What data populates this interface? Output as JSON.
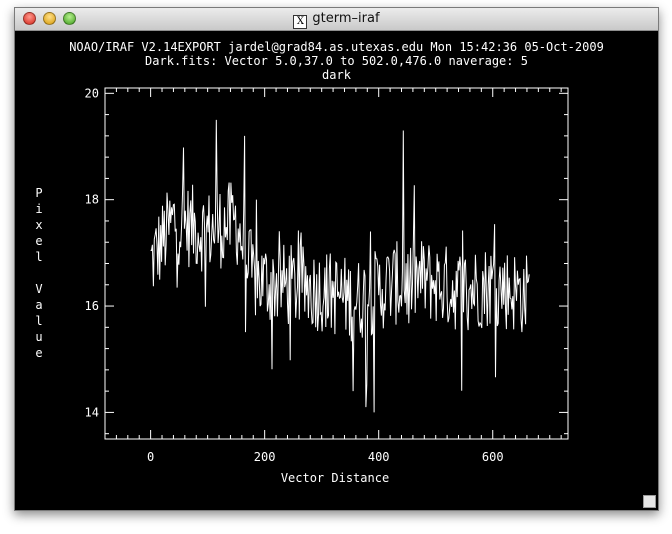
{
  "window": {
    "title": "gterm–iraf",
    "icon": "x11-icon"
  },
  "header": {
    "line1": "NOAO/IRAF V2.14EXPORT jardel@grad84.as.utexas.edu Mon 15:42:36 05-Oct-2009",
    "line2": "Dark.fits: Vector 5.0,37.0 to 502.0,476.0 naverage: 5",
    "line3": "dark"
  },
  "chart_data": {
    "type": "line",
    "title": "dark",
    "xlabel": "Vector Distance",
    "ylabel": "Pixel Value",
    "xlim": [
      -80,
      732
    ],
    "ylim": [
      13.5,
      20.1
    ],
    "xticks": [
      0,
      200,
      400,
      600
    ],
    "yticks": [
      14,
      16,
      18,
      20
    ],
    "x_start": 0,
    "x_end": 665,
    "series": [
      {
        "color": "#ffffff",
        "trend_x": [
          0,
          40,
          100,
          150,
          180,
          230,
          300,
          360,
          420,
          480,
          540,
          600,
          665
        ],
        "trend_y": [
          16.8,
          17.6,
          17.4,
          17.6,
          16.5,
          16.4,
          16.3,
          16.1,
          16.4,
          16.5,
          16.3,
          16.4,
          16.2
        ],
        "noise_amplitude": 0.8,
        "peaks": [
          [
            115,
            19.5
          ],
          [
            165,
            19.2
          ],
          [
            443,
            19.3
          ],
          [
            392,
            14.0
          ],
          [
            378,
            14.1
          ],
          [
            355,
            14.4
          ]
        ]
      }
    ],
    "grid": false,
    "legend": "none"
  }
}
